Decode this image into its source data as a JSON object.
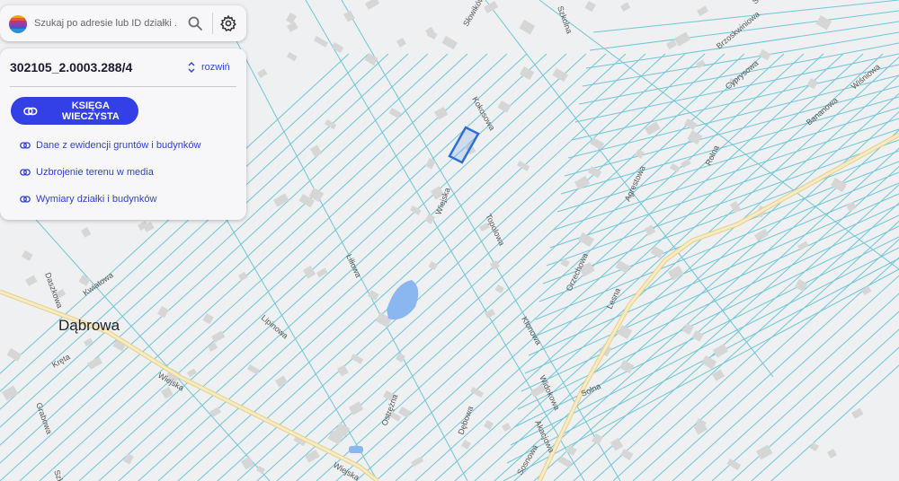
{
  "search": {
    "placeholder": "Szukaj po adresie lub ID działki ..."
  },
  "panel": {
    "parcel_id": "302105_2.0003.288/4",
    "expand_label": "rozwiń",
    "kw_button_label": "KSIĘGA WIECZYSTA",
    "links": [
      "Dane z ewidencji gruntów i budynków",
      "Uzbrojenie terenu w media",
      "Wymiary działki i budynków"
    ]
  },
  "map": {
    "place_label": "Dąbrowa",
    "street_labels": [
      "Słowików",
      "Szkolna",
      "Kokosowa",
      "Wiejska",
      "Topolowa",
      "Liliowa",
      "Lipinowa",
      "Kwiatowa",
      "Daszkowa",
      "Kręta",
      "Wiejska",
      "Ostrężna",
      "Dębowa",
      "Klonowa",
      "Widokowa",
      "Akacjowa",
      "Sosnowa",
      "Lesna",
      "Orzechowa",
      "Solna",
      "Agrestowa",
      "Rolna",
      "Cyprysowa",
      "Brzoskwiniowa",
      "Bananowa",
      "Wiśniowa",
      "Świrkowa",
      "Grabowa",
      "Wiejska",
      "Szkolna"
    ],
    "colors": {
      "parcel_line": "#6fc6d8",
      "road": "#f3e2a6",
      "highlight": "#2c6fd8",
      "water": "#8bb7f0"
    }
  }
}
